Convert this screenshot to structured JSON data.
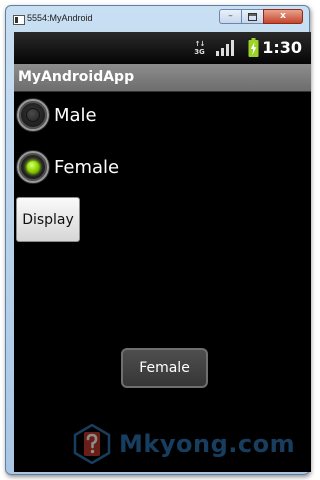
{
  "window": {
    "title": "5554:MyAndroid",
    "minimize_glyph": "–",
    "close_glyph": "x"
  },
  "status_bar": {
    "network_type": "3G",
    "time": "1:30",
    "signal_bars": 4,
    "battery_icon": "battery-charging-icon",
    "battery_color": "#9bd22a"
  },
  "app_bar": {
    "title": "MyAndroidApp"
  },
  "radio_group": {
    "options": [
      {
        "label": "Male",
        "checked": false
      },
      {
        "label": "Female",
        "checked": true
      }
    ]
  },
  "display_button": {
    "label": "Display"
  },
  "toast": {
    "text": "Female"
  },
  "watermark": {
    "text_part1": "Mkyong",
    "text_part2": ".com",
    "icon": "question-mark-logo-icon",
    "color": "#2a6fae",
    "logo_color": "#c0392b"
  }
}
